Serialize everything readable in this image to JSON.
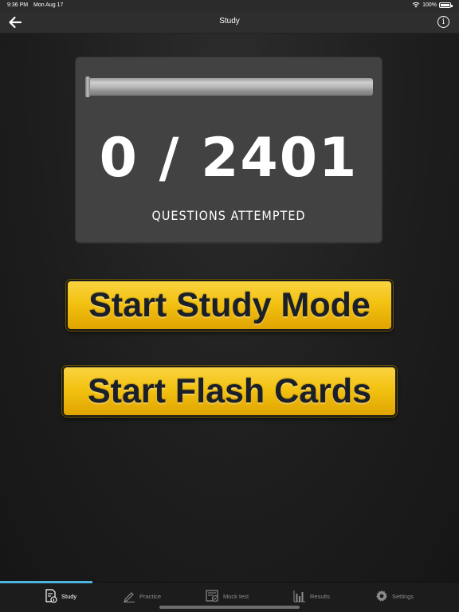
{
  "status_bar": {
    "time": "9:36 PM",
    "date": "Mon Aug 17",
    "battery": "100%"
  },
  "nav": {
    "title": "Study"
  },
  "progress": {
    "attempted": 0,
    "total": 2401,
    "counter_text": "0 / 2401",
    "label": "QUESTIONS ATTEMPTED",
    "fill_fraction": 0
  },
  "buttons": {
    "study_mode": "Start Study Mode",
    "flash_cards": "Start Flash Cards"
  },
  "tabs": [
    {
      "label": "Study",
      "icon": "study-document-icon",
      "active": true
    },
    {
      "label": "Practice",
      "icon": "pencil-icon",
      "active": false
    },
    {
      "label": "Mock test",
      "icon": "test-form-icon",
      "active": false
    },
    {
      "label": "Results",
      "icon": "bar-chart-icon",
      "active": false
    },
    {
      "label": "Settings",
      "icon": "gear-icon",
      "active": false
    }
  ],
  "colors": {
    "accent": "#4fb3e0",
    "button_yellow": "#f3c212",
    "background": "#1e1e1e"
  }
}
